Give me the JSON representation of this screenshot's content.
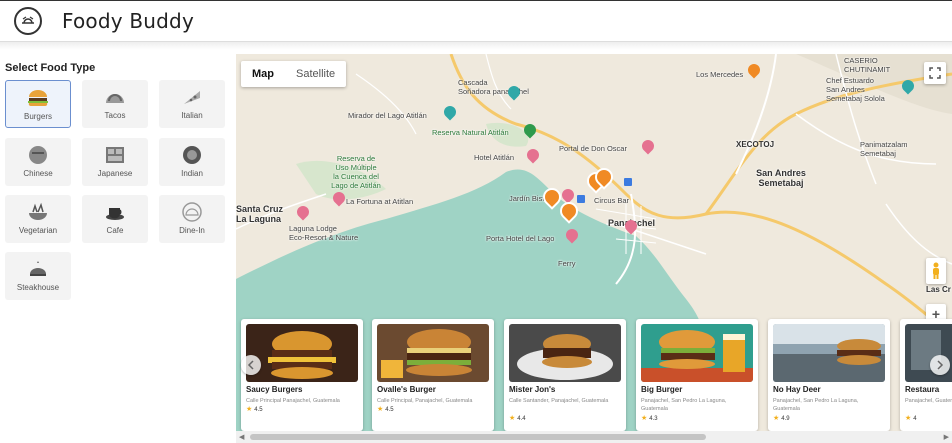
{
  "header": {
    "title": "Foody Buddy",
    "logo_icon": "tray-icon"
  },
  "sidebar": {
    "title": "Select Food Type",
    "food_types": [
      {
        "label": "Burgers",
        "icon": "burger-icon",
        "selected": true
      },
      {
        "label": "Tacos",
        "icon": "taco-icon",
        "selected": false
      },
      {
        "label": "Italian",
        "icon": "pizza-icon",
        "selected": false
      },
      {
        "label": "Chinese",
        "icon": "chinese-food-icon",
        "selected": false
      },
      {
        "label": "Japanese",
        "icon": "bento-icon",
        "selected": false
      },
      {
        "label": "Indian",
        "icon": "curry-icon",
        "selected": false
      },
      {
        "label": "Vegetarian",
        "icon": "salad-icon",
        "selected": false
      },
      {
        "label": "Cafe",
        "icon": "coffee-icon",
        "selected": false
      },
      {
        "label": "Dine-In",
        "icon": "cloche-icon",
        "selected": false
      },
      {
        "label": "Steakhouse",
        "icon": "steak-icon",
        "selected": false
      }
    ]
  },
  "map": {
    "toggle": {
      "map": "Map",
      "satellite": "Satellite",
      "active": "Map"
    },
    "labels": {
      "chutinamit": "CASERIO\nCHUTINAMIT",
      "los_mercedes": "Los Mercedes",
      "cascada": "Cascada\nSoñadora panajachel",
      "chef": "Chef Estuardo\nSan Andres\nSemetabaj Solola",
      "mirador": "Mirador del Lago Atitlán",
      "reserva": "Reserva Natural Atitlán",
      "portal_don_oscar": "Portal de Don Oscar",
      "hotel_atitlan": "Hotel Atitlán",
      "xecotoj": "XECOTOJ",
      "panimatzalam": "Panimatzalam\nSemetabaj",
      "reserva_uso": "Reserva de\nUso Múltiple\nla Cuenca del\nLago de Atitlán",
      "la_fortuna": "La Fortuna at Atitlan",
      "san_andres": "San Andres\nSemetabaj",
      "santa_cruz": "Santa Cruz\nLa Laguna",
      "jardin": "Jardín Bistro",
      "circus_bar": "Circus Bar",
      "panajachel": "Panajachel",
      "laguna_lodge": "Laguna Lodge\nEco-Resort & Nature",
      "porta_hotel": "Porta Hotel del Lago",
      "ferry": "Ferry",
      "las_cruces": "Las Cr"
    },
    "controls": {
      "fullscreen": "fullscreen-icon",
      "pegman": "pegman-icon",
      "zoom_in": "+"
    }
  },
  "restaurants": [
    {
      "name": "Saucy Burgers",
      "address": "Calle Principal Panajachel, Guatemala",
      "rating": "4.5"
    },
    {
      "name": "Ovalle's Burger",
      "address": "Calle Principal, Panajachel, Guatemala",
      "rating": "4.5"
    },
    {
      "name": "Mister Jon's",
      "address": "Calle Santander, Panajachel, Guatemala",
      "rating": "4.4"
    },
    {
      "name": "Big Burger",
      "address": "Panajachel, San Pedro La Laguna, Guatemala",
      "rating": "4.3"
    },
    {
      "name": "No Hay Deer",
      "address": "Panajachel, San Pedro La Laguna, Guatemala",
      "rating": "4.9"
    },
    {
      "name": "Restaura",
      "address": "Panajachel, Guatemala",
      "rating": "4"
    }
  ],
  "colors": {
    "accent": "#6b8fcf",
    "lake": "#9fd3c5",
    "land": "#efe9dd",
    "road": "#f5c96b",
    "star": "#f2b01e"
  }
}
